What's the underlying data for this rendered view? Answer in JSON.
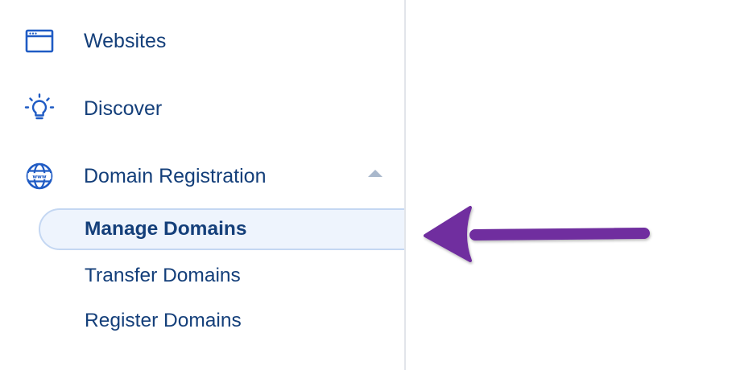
{
  "sidebar": {
    "items": [
      {
        "label": "Websites",
        "icon": "browser-window-icon"
      },
      {
        "label": "Discover",
        "icon": "lightbulb-icon"
      },
      {
        "label": "Domain Registration",
        "icon": "globe-www-icon",
        "expanded": true
      }
    ],
    "sub_items": [
      {
        "label": "Manage Domains",
        "active": true
      },
      {
        "label": "Transfer Domains",
        "active": false
      },
      {
        "label": "Register Domains",
        "active": false
      }
    ]
  },
  "annotation": {
    "type": "arrow",
    "color": "#6f2f9f",
    "points_to": "Manage Domains"
  },
  "colors": {
    "text": "#143f7a",
    "icon": "#1f5bc4",
    "active_bg": "#eef4fd",
    "active_border": "#c4d7f2",
    "divider": "#e2e5ea",
    "caret": "#a9b8cc",
    "arrow": "#6f2f9f"
  }
}
